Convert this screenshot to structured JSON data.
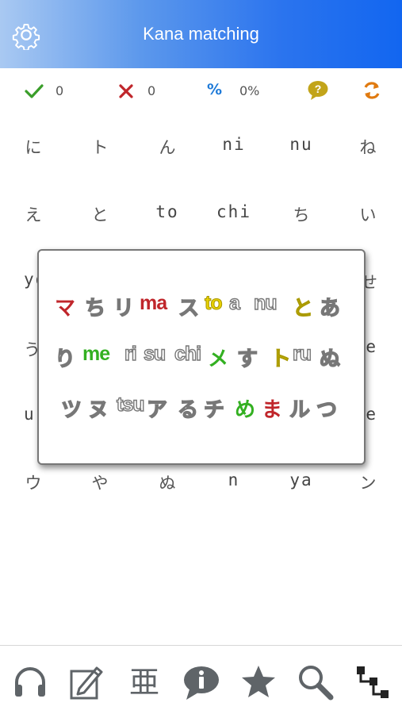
{
  "header": {
    "title": "Kana matching",
    "settings_icon": "gear-icon"
  },
  "stats": {
    "correct": {
      "icon": "check-icon",
      "value": "0",
      "color": "#3a9e2a"
    },
    "wrong": {
      "icon": "cross-icon",
      "value": "0",
      "color": "#c0262b"
    },
    "percent": {
      "icon": "percent-icon",
      "symbol": "%",
      "value": "0%",
      "color": "#1e7ad8"
    },
    "help_icon": "help-bubble-icon",
    "refresh_icon": "refresh-icon"
  },
  "grid": {
    "rows": [
      [
        "に",
        "ト",
        "ん",
        "ni",
        "nu",
        "ね"
      ],
      [
        "え",
        "と",
        "to",
        "chi",
        "ち",
        "い"
      ],
      [
        "yo",
        "",
        "",
        "",
        "",
        "せ"
      ],
      [
        "う",
        "",
        "",
        "",
        "",
        "ne"
      ],
      [
        "u",
        "",
        "",
        "",
        "",
        "e"
      ],
      [
        "ウ",
        "や",
        "ぬ",
        "n",
        "ya",
        "ン"
      ]
    ]
  },
  "popup": {
    "rows": [
      [
        {
          "t": "マ",
          "c": "red"
        },
        {
          "t": "ち",
          "c": "white"
        },
        {
          "t": "リ",
          "c": "white"
        },
        {
          "t": "ma",
          "c": "red"
        },
        {
          "t": "ス",
          "c": "white"
        },
        {
          "t": "to",
          "c": "yellow"
        },
        {
          "t": "a",
          "c": "white"
        },
        {
          "t": "nu",
          "c": "white"
        },
        {
          "t": "と",
          "c": "yellow"
        },
        {
          "t": "あ",
          "c": "white"
        }
      ],
      [
        {
          "t": "り",
          "c": "white"
        },
        {
          "t": "me",
          "c": "green"
        },
        {
          "t": "ri",
          "c": "white"
        },
        {
          "t": "su",
          "c": "white"
        },
        {
          "t": "chi",
          "c": "white"
        },
        {
          "t": "メ",
          "c": "green"
        },
        {
          "t": "す",
          "c": "white"
        },
        {
          "t": "ト",
          "c": "yellow"
        },
        {
          "t": "ru",
          "c": "white"
        },
        {
          "t": "ぬ",
          "c": "white"
        }
      ],
      [
        {
          "t": "ツ",
          "c": "white"
        },
        {
          "t": "ヌ",
          "c": "white"
        },
        {
          "t": "tsu",
          "c": "white"
        },
        {
          "t": "ア",
          "c": "white"
        },
        {
          "t": "る",
          "c": "white"
        },
        {
          "t": "チ",
          "c": "white"
        },
        {
          "t": "め",
          "c": "green"
        },
        {
          "t": "ま",
          "c": "red"
        },
        {
          "t": "ル",
          "c": "white"
        },
        {
          "t": "つ",
          "c": "white"
        }
      ]
    ]
  },
  "bottom_nav": {
    "items": [
      {
        "icon": "headphones-icon"
      },
      {
        "icon": "notepad-pencil-icon"
      },
      {
        "icon": "kanji-grid-icon",
        "glyph": "亜"
      },
      {
        "icon": "info-bubble-icon"
      },
      {
        "icon": "star-icon"
      },
      {
        "icon": "search-icon"
      },
      {
        "icon": "flow-connect-icon"
      }
    ]
  }
}
